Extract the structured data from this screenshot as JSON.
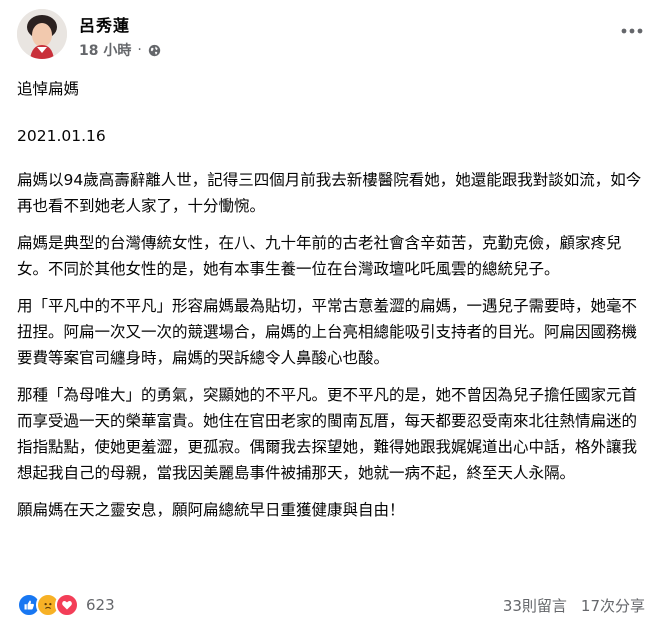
{
  "post": {
    "author": "呂秀蓮",
    "time": "18 小時",
    "separator": "·",
    "icons": {
      "avatar": "profile-photo",
      "privacy": "globe-icon",
      "more": "more-options-icon"
    },
    "title": "追悼扁媽",
    "date": "2021.01.16",
    "paragraphs": [
      " 扁媽以94歲高壽辭離人世，記得三四個月前我去新樓醫院看她，她還能跟我對談如流，如今再也看不到她老人家了，十分慟惋。",
      " 扁媽是典型的台灣傳統女性，在八、九十年前的古老社會含辛茹苦，克勤克儉，顧家疼兒女。不同於其他女性的是，她有本事生養一位在台灣政壇叱吒風雲的總統兒子。",
      " 用「平凡中的不平凡」形容扁媽最為貼切，平常古意羞澀的扁媽，一遇兒子需要時，她毫不扭捏。阿扁一次又一次的競選場合，扁媽的上台亮相總能吸引支持者的目光。阿扁因國務機要費等案官司纏身時，扁媽的哭訴總令人鼻酸心也酸。",
      " 那種「為母唯大」的勇氣，突顯她的不平凡。更不平凡的是，她不曾因為兒子擔任國家元首而享受過一天的榮華富貴。她住在官田老家的閩南瓦厝，每天都要忍受南來北往熱情扁迷的指指點點，使她更羞澀，更孤寂。偶爾我去探望她，難得她跟我娓娓道出心中話，格外讓我想起我自己的母親，當我因美麗島事件被捕那天，她就一病不起，終至天人永隔。",
      "願扁媽在天之靈安息，願阿扁總統早日重獲健康與自由！"
    ]
  },
  "footer": {
    "reaction_icons": [
      "like-icon",
      "sad-icon",
      "love-icon"
    ],
    "reaction_colors": {
      "like": "#1877f2",
      "sad": "#f7b125",
      "love": "#f33e58"
    },
    "reaction_count": "623",
    "comments": "33則留言",
    "shares": "17次分享"
  }
}
